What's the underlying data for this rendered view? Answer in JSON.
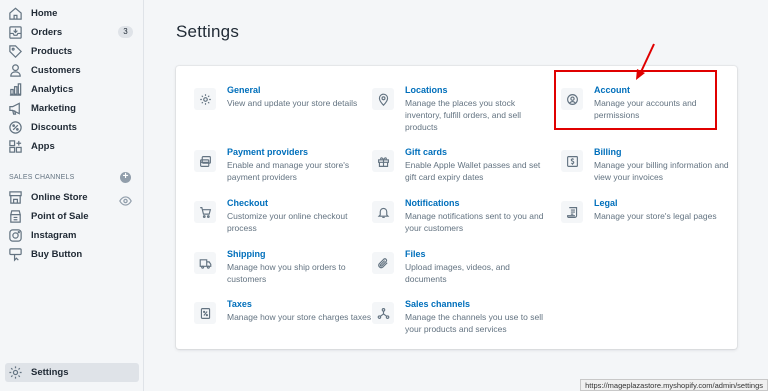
{
  "sidebar": {
    "items": [
      {
        "label": "Home",
        "icon": "home-icon"
      },
      {
        "label": "Orders",
        "icon": "orders-icon",
        "badge": "3"
      },
      {
        "label": "Products",
        "icon": "tag-icon"
      },
      {
        "label": "Customers",
        "icon": "customers-icon"
      },
      {
        "label": "Analytics",
        "icon": "analytics-icon"
      },
      {
        "label": "Marketing",
        "icon": "megaphone-icon"
      },
      {
        "label": "Discounts",
        "icon": "discount-icon"
      },
      {
        "label": "Apps",
        "icon": "apps-icon"
      }
    ],
    "sales_channels_heading": "SALES CHANNELS",
    "channels": [
      {
        "label": "Online Store",
        "icon": "store-icon"
      },
      {
        "label": "Point of Sale",
        "icon": "pos-icon"
      },
      {
        "label": "Instagram",
        "icon": "instagram-icon"
      },
      {
        "label": "Buy Button",
        "icon": "buy-button-icon"
      }
    ],
    "settings_label": "Settings"
  },
  "main": {
    "title": "Settings",
    "tiles": [
      {
        "title": "General",
        "desc": "View and update your store details",
        "icon": "gear-icon"
      },
      {
        "title": "Locations",
        "desc": "Manage the places you stock inventory, fulfill orders, and sell products",
        "icon": "location-pin-icon"
      },
      {
        "title": "Account",
        "desc": "Manage your accounts and permissions",
        "icon": "account-icon"
      },
      {
        "title": "Payment providers",
        "desc": "Enable and manage your store's payment providers",
        "icon": "payment-icon"
      },
      {
        "title": "Gift cards",
        "desc": "Enable Apple Wallet passes and set gift card expiry dates",
        "icon": "gift-icon"
      },
      {
        "title": "Billing",
        "desc": "Manage your billing information and view your invoices",
        "icon": "billing-icon"
      },
      {
        "title": "Checkout",
        "desc": "Customize your online checkout process",
        "icon": "cart-icon"
      },
      {
        "title": "Notifications",
        "desc": "Manage notifications sent to you and your customers",
        "icon": "bell-icon"
      },
      {
        "title": "Legal",
        "desc": "Manage your store's legal pages",
        "icon": "legal-icon"
      },
      {
        "title": "Shipping",
        "desc": "Manage how you ship orders to customers",
        "icon": "truck-icon"
      },
      {
        "title": "Files",
        "desc": "Upload images, videos, and documents",
        "icon": "paperclip-icon"
      },
      {
        "title": "Taxes",
        "desc": "Manage how your store charges taxes",
        "icon": "taxes-icon"
      },
      {
        "title": "Sales channels",
        "desc": "Manage the channels you use to sell your products and services",
        "icon": "channels-icon"
      }
    ]
  },
  "colors": {
    "link": "#006fbb",
    "highlight": "#e00000",
    "text_muted": "#637381"
  },
  "status_url": "https://mageplazastore.myshopify.com/admin/settings"
}
